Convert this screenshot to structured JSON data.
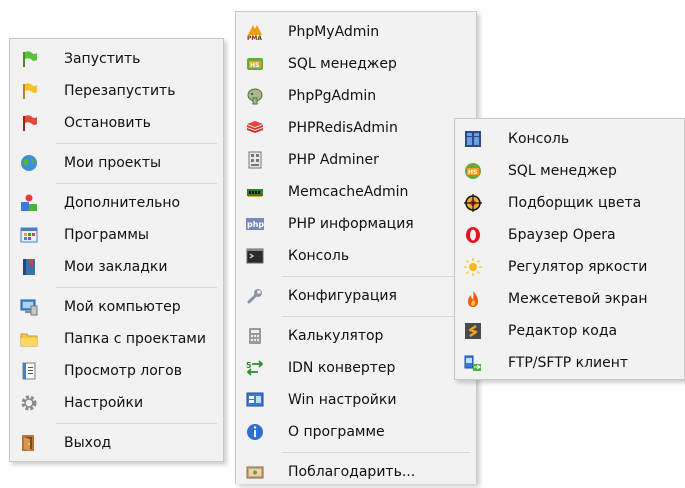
{
  "main_menu": {
    "items": [
      {
        "label": "Запустить",
        "icon": "green-flag-icon"
      },
      {
        "label": "Перезапустить",
        "icon": "yellow-flag-icon"
      },
      {
        "label": "Остановить",
        "icon": "red-flag-icon"
      },
      {
        "label": "Мои проекты",
        "icon": "globe-icon"
      },
      {
        "label": "Дополнительно",
        "icon": "shapes-icon"
      },
      {
        "label": "Программы",
        "icon": "app-grid-icon"
      },
      {
        "label": "Мои закладки",
        "icon": "bookmarks-icon"
      },
      {
        "label": "Мой компьютер",
        "icon": "computer-icon"
      },
      {
        "label": "Папка с проектами",
        "icon": "folder-icon"
      },
      {
        "label": "Просмотр логов",
        "icon": "log-document-icon"
      },
      {
        "label": "Настройки",
        "icon": "gear-icon"
      },
      {
        "label": "Выход",
        "icon": "exit-door-icon"
      }
    ]
  },
  "tools_menu": {
    "items": [
      {
        "label": "PhpMyAdmin",
        "icon": "phpmyadmin-icon"
      },
      {
        "label": "SQL менеджер",
        "icon": "sql-manager-icon"
      },
      {
        "label": "PhpPgAdmin",
        "icon": "postgres-elephant-icon"
      },
      {
        "label": "PHPRedisAdmin",
        "icon": "redis-icon"
      },
      {
        "label": "PHP Adminer",
        "icon": "adminer-icon"
      },
      {
        "label": "MemcacheAdmin",
        "icon": "memory-chip-icon"
      },
      {
        "label": "PHP информация",
        "icon": "php-icon"
      },
      {
        "label": "Консоль",
        "icon": "console-icon"
      },
      {
        "label": "Конфигурация",
        "icon": "wrench-icon"
      },
      {
        "label": "Калькулятор",
        "icon": "calculator-icon"
      },
      {
        "label": "IDN конвертер",
        "icon": "idn-convert-icon"
      },
      {
        "label": "Win настройки",
        "icon": "windows-settings-icon"
      },
      {
        "label": "О программе",
        "icon": "info-icon"
      },
      {
        "label": "Поблагодарить...",
        "icon": "thanks-icon"
      }
    ]
  },
  "submenu": {
    "items": [
      {
        "label": "Консоль",
        "icon": "console-columns-icon"
      },
      {
        "label": "SQL менеджер",
        "icon": "sql-manager-icon"
      },
      {
        "label": "Подборщик цвета",
        "icon": "color-picker-icon"
      },
      {
        "label": "Браузер Opera",
        "icon": "opera-icon"
      },
      {
        "label": "Регулятор яркости",
        "icon": "sun-brightness-icon"
      },
      {
        "label": "Межсетевой экран",
        "icon": "firewall-flame-icon"
      },
      {
        "label": "Редактор кода",
        "icon": "code-editor-icon"
      },
      {
        "label": "FTP/SFTP клиент",
        "icon": "ftp-client-icon"
      }
    ]
  },
  "colors": {
    "menu_bg": "#f2f2f2",
    "separator": "#d6d6d6",
    "border": "#c8c8c8"
  }
}
